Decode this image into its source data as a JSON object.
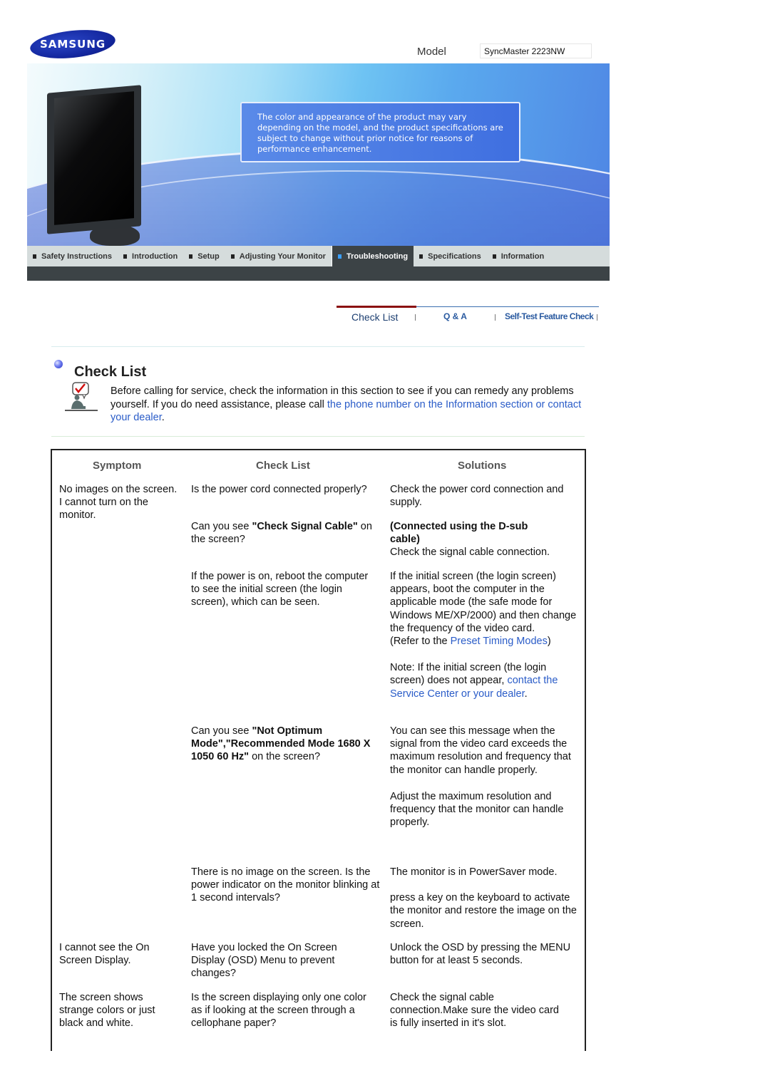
{
  "header": {
    "brand": "SAMSUNG",
    "model_label": "Model",
    "model_value": "SyncMaster 2223NW"
  },
  "banner": {
    "notice": "The color and appearance of the product may vary depending on the model, and the product specifications are subject to change without prior notice for reasons of performance enhancement."
  },
  "nav": {
    "items": [
      {
        "label": "Safety Instructions",
        "active": false
      },
      {
        "label": "Introduction",
        "active": false
      },
      {
        "label": "Setup",
        "active": false
      },
      {
        "label": "Adjusting Your Monitor",
        "active": false
      },
      {
        "label": "Troubleshooting",
        "active": true
      },
      {
        "label": "Specifications",
        "active": false
      },
      {
        "label": "Information",
        "active": false
      }
    ]
  },
  "subtabs": [
    {
      "label": "Check List",
      "active": true
    },
    {
      "label": "Q & A",
      "active": false
    },
    {
      "label": "Self-Test Feature Check",
      "active": false
    }
  ],
  "section": {
    "title": "Check List",
    "intro_text": "Before calling for service, check the information in this section to see if you can remedy any problems yourself. If you do need assistance, please call ",
    "intro_link": "the phone number on the Information section or contact your dealer",
    "intro_end": "."
  },
  "table": {
    "headers": {
      "symptom": "Symptom",
      "check": "Check List",
      "solutions": "Solutions"
    },
    "rows": [
      {
        "symptom": "No images on the screen. I cannot turn on the monitor.",
        "check": "Is the power cord connected properly?",
        "solution": "Check the power cord connection and supply."
      },
      {
        "check_pre": "Can you see ",
        "check_bold": "\"Check Signal Cable\"",
        "check_post": " on the screen?",
        "solution_bold": "(Connected using the D-sub cable)",
        "solution": "Check the signal cable connection."
      },
      {
        "check": "If the power is on, reboot the computer to see the initial screen (the login screen), which can be seen.",
        "solution": "If the initial screen (the login screen) appears, boot the computer in the applicable mode (the safe mode for Windows ME/XP/2000) and then change the frequency of the video card.",
        "refer_pre": "(Refer to the ",
        "refer_link": "Preset Timing Modes",
        "refer_post": ")",
        "note_pre": "Note: If the initial screen (the login screen) does not appear, ",
        "note_link": "contact the Service Center or your dealer",
        "note_post": "."
      },
      {
        "check_pre": "Can you see ",
        "check_bold": "\"Not Optimum Mode\",\"Recommended Mode 1680 X 1050 60 Hz\"",
        "check_post": " on the screen?",
        "solution": "You can see this message when the signal from the video card exceeds the maximum resolution and frequency that the monitor can handle properly.",
        "solution2": "Adjust the maximum resolution and frequency that the monitor can handle properly."
      },
      {
        "check": "There is no image on the screen. Is the power indicator on the monitor blinking at 1 second intervals?",
        "solution": "The monitor is in PowerSaver mode.",
        "solution2": "press a key on the keyboard to activate the monitor and restore the image on the screen."
      },
      {
        "symptom": "I cannot see the On Screen Display.",
        "check": "Have you locked the On Screen Display (OSD) Menu to prevent changes?",
        "solution": "Unlock the OSD by pressing the MENU button for at least 5 seconds."
      },
      {
        "symptom": "The screen shows strange colors or just black and white.",
        "check": "Is the screen displaying only one color as if looking at the screen through a cellophane paper?",
        "solution": "Check the signal cable connection.Make sure the video card is fully inserted in it's slot."
      }
    ]
  }
}
